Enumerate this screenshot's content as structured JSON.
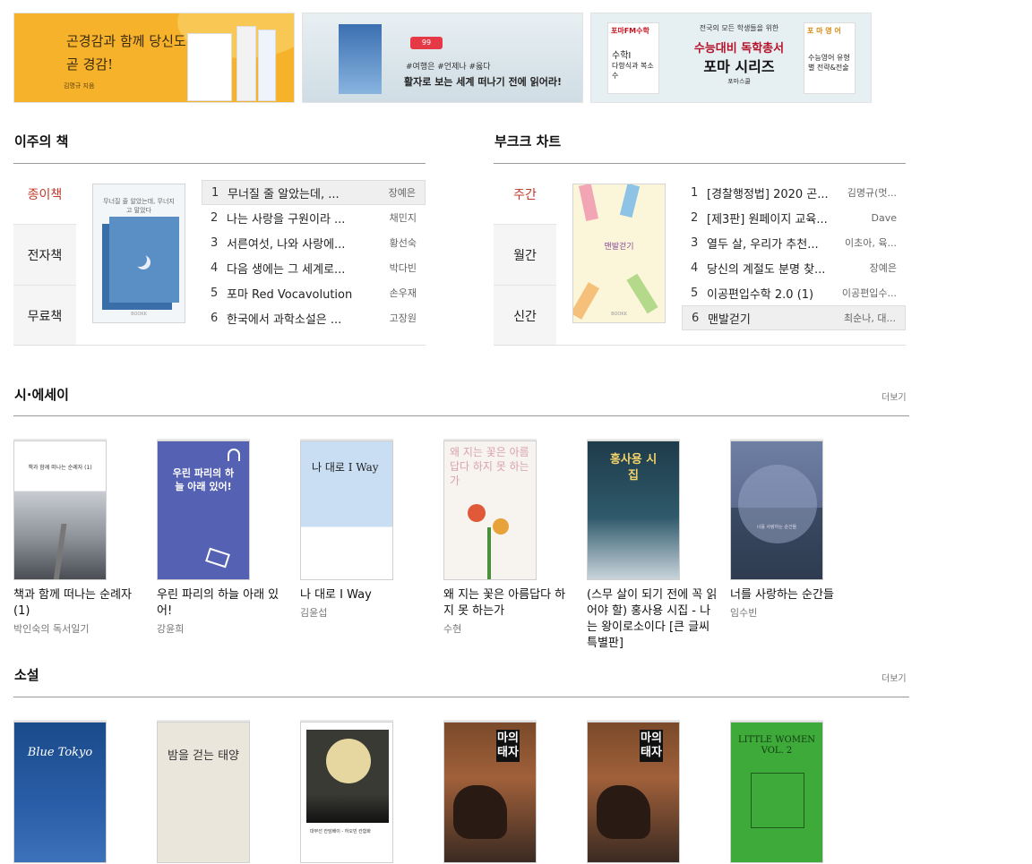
{
  "banners": [
    {
      "headline": "곤경감과 함께 당신도 곧 경감!",
      "author": "김명규 지음"
    },
    {
      "likes": "99",
      "hashtags": "#여행은 #언제나 #옳다",
      "catchphrase": "활자로 보는 세계 떠나기 전에 읽어라!"
    },
    {
      "line1": "전국의 모든 학생들을 위한",
      "line2": "수능대비 독학총서",
      "line3": "포마 시리즈",
      "line4": "포마스쿨",
      "book1_head": "포마FM수학",
      "book1_title": "수학Ⅰ",
      "book1_sub": "다항식과 복소수",
      "book2_head": "포 마 영 어",
      "book2_title": "수능영어 유형별 전략&전술"
    }
  ],
  "weekly": {
    "title": "이주의 책",
    "tabs": [
      "종이책",
      "전자책",
      "무료책"
    ],
    "cover_text": "무너질 줄 알았는데, 무너지고 말았다",
    "brand": "BOOKK",
    "items": [
      {
        "rank": "1",
        "title": "무너질 줄 알았는데, ...",
        "author": "장예은"
      },
      {
        "rank": "2",
        "title": "나는 사랑을 구원이라 ...",
        "author": "채민지"
      },
      {
        "rank": "3",
        "title": "서른여섯, 나와 사랑에...",
        "author": "황선숙"
      },
      {
        "rank": "4",
        "title": "다음 생에는 그 세계로...",
        "author": "박다빈"
      },
      {
        "rank": "5",
        "title": "포마 Red Vocavolution",
        "author": "손우재"
      },
      {
        "rank": "6",
        "title": "한국에서 과학소설은 ...",
        "author": "고장원"
      }
    ]
  },
  "chart": {
    "title": "부크크 차트",
    "tabs": [
      "주간",
      "월간",
      "신간"
    ],
    "cover_text": "맨발걷기",
    "items": [
      {
        "rank": "1",
        "title": "[경찰행정법] 2020 곤...",
        "author": "김명규(멋..."
      },
      {
        "rank": "2",
        "title": "[제3판] 원페이지 교육...",
        "author": "Dave"
      },
      {
        "rank": "3",
        "title": "열두 살, 우리가 추천...",
        "author": "이초아, 육..."
      },
      {
        "rank": "4",
        "title": "당신의 계절도 분명 찾...",
        "author": "장예은"
      },
      {
        "rank": "5",
        "title": "이공편입수학 2.0 (1)",
        "author": "이공편입수..."
      },
      {
        "rank": "6",
        "title": "맨발걷기",
        "author": "최순나, 대..."
      }
    ]
  },
  "poetry": {
    "title": "시·에세이",
    "more": "더보기",
    "books": [
      {
        "title": "책과 함께 떠나는 순례자 (1)",
        "author": "박인숙의 독서일기",
        "cover": "책과 함께 떠나는 순례자 (1)"
      },
      {
        "title": "우린 파리의 하늘 아래 있어!",
        "author": "강윤희",
        "cover": "우린 파리의 하늘 아래 있어!"
      },
      {
        "title": "나 대로 I Way",
        "author": "김윤섭",
        "cover": "나 대로 I Way"
      },
      {
        "title": "왜 지는 꽃은 아름답다 하지 못 하는가",
        "author": "수현",
        "cover": "왜 지는 꽃은 아름답다 하지 못 하는가"
      },
      {
        "title": "(스무 살이 되기 전에 꼭 읽어야 할) 홍사용 시집 - 나는 왕이로소이다 [큰 글씨 특별판]",
        "author": "",
        "cover": "홍사용 시집"
      },
      {
        "title": "너를 사랑하는 순간들",
        "author": "임수빈",
        "cover": "너를 사랑하는 순간들"
      }
    ]
  },
  "novel": {
    "title": "소설",
    "more": "더보기",
    "books": [
      {
        "cover": "Blue Tokyo"
      },
      {
        "cover": "밤을 걷는 태양"
      },
      {
        "cover": "대부선 칸담배이 - 하오빈 칸함화"
      },
      {
        "cover": "마의태자"
      },
      {
        "cover": "마의태자"
      },
      {
        "cover": "LITTLE WOMEN VOL. 2"
      }
    ]
  }
}
